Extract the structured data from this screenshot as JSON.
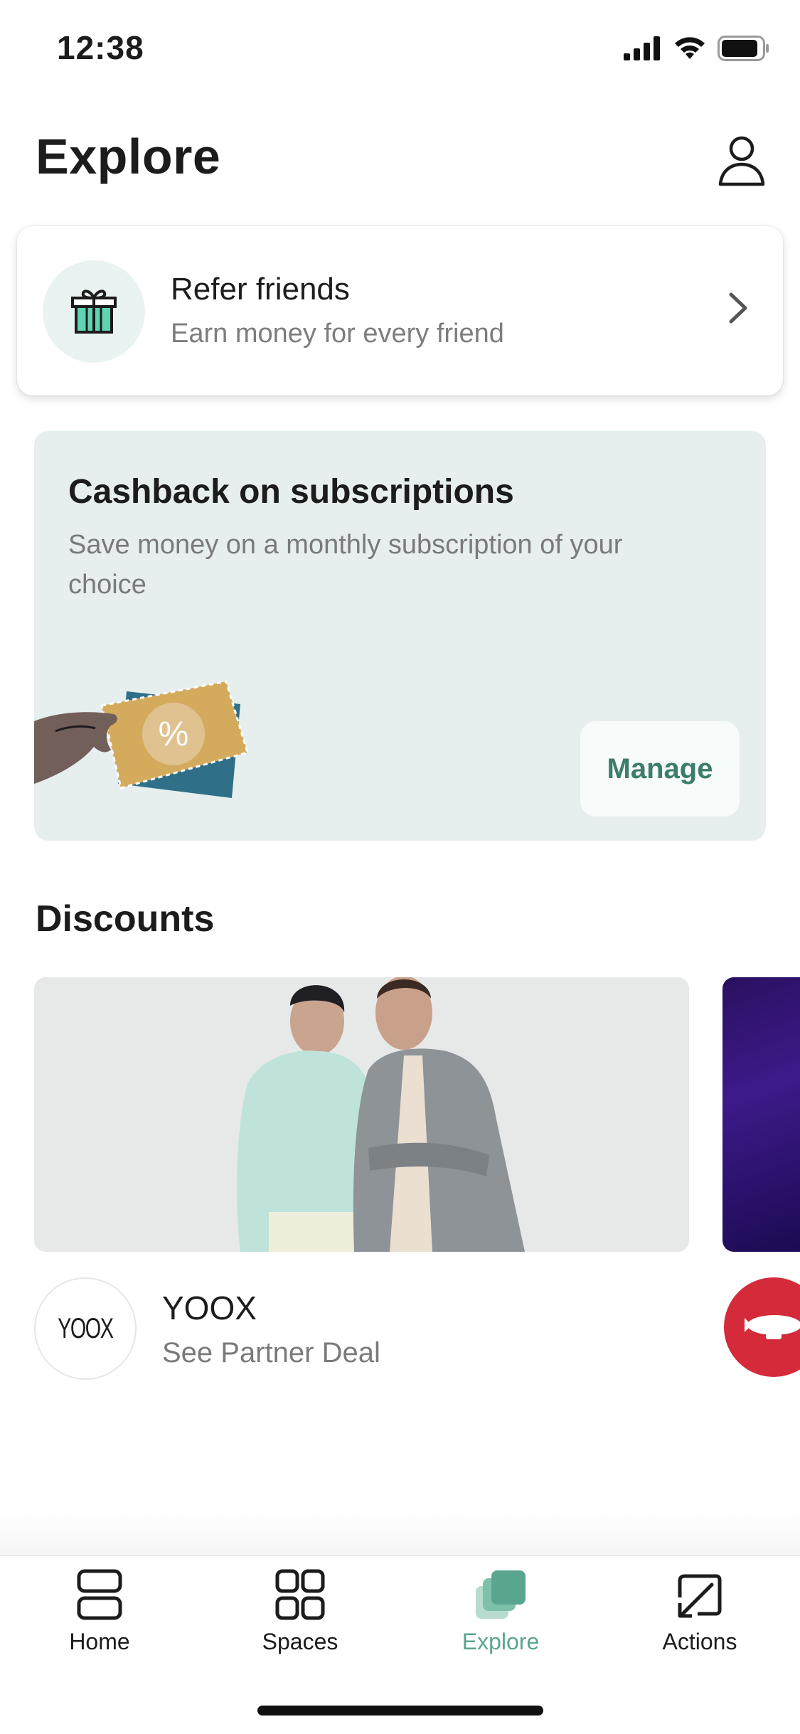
{
  "status_bar": {
    "time": "12:38"
  },
  "header": {
    "title": "Explore"
  },
  "refer": {
    "title": "Refer friends",
    "subtitle": "Earn money for every friend"
  },
  "cashback": {
    "title": "Cashback on subscriptions",
    "subtitle": "Save money on a monthly subscription of your choice",
    "button_label": "Manage"
  },
  "discounts": {
    "title": "Discounts",
    "deals": [
      {
        "name": "YOOX",
        "subtitle": "See Partner Deal",
        "logo_text": "YOOX"
      }
    ]
  },
  "tabs": [
    {
      "label": "Home",
      "icon": "home-icon",
      "active": false
    },
    {
      "label": "Spaces",
      "icon": "spaces-icon",
      "active": false
    },
    {
      "label": "Explore",
      "icon": "explore-icon",
      "active": true
    },
    {
      "label": "Actions",
      "icon": "actions-icon",
      "active": false
    }
  ],
  "colors": {
    "accent": "#5aa590",
    "manage_text": "#3c7d6c",
    "card_bg": "#e6eeee"
  }
}
